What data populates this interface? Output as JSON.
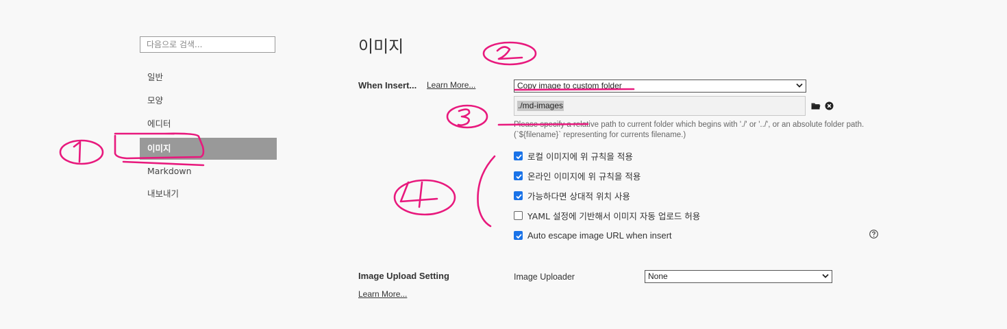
{
  "sidebar": {
    "search_placeholder": "다음으로 검색...",
    "items": [
      {
        "label": "일반"
      },
      {
        "label": "모양"
      },
      {
        "label": "에디터"
      },
      {
        "label": "이미지",
        "active": true
      },
      {
        "label": "Markdown"
      },
      {
        "label": "내보내기"
      }
    ]
  },
  "main": {
    "title": "이미지",
    "when_insert": {
      "label": "When Insert...",
      "learn_more": "Learn More...",
      "action_select": "Copy image to custom folder",
      "folder_value": "./md-images",
      "folder_icon": "folder-icon",
      "clear_icon": "clear-circle-icon",
      "hint": "Please specify a relative path to current folder which begins with './' or '../', or an absolute folder path. (`${filename}` representing for currents filename.)"
    },
    "options": [
      {
        "label": "로컬 이미지에 위 규칙을 적용",
        "checked": true
      },
      {
        "label": "온라인 이미지에 위 규칙을 적용",
        "checked": true
      },
      {
        "label": "가능하다면 상대적 위치 사용",
        "checked": true
      },
      {
        "label": "YAML 설정에 기반해서 이미지 자동 업로드 허용",
        "checked": false
      },
      {
        "label": "Auto escape image URL when insert",
        "checked": true
      }
    ],
    "help_icon": "question-circle-icon",
    "upload": {
      "label": "Image Upload Setting",
      "learn_more": "Learn More...",
      "uploader_label": "Image Uploader",
      "uploader_value": "None"
    }
  },
  "colors": {
    "background": "#f8f8f8",
    "active_item": "#999999",
    "checkbox_on": "#1a73e8",
    "annotation": "#e8197d"
  }
}
